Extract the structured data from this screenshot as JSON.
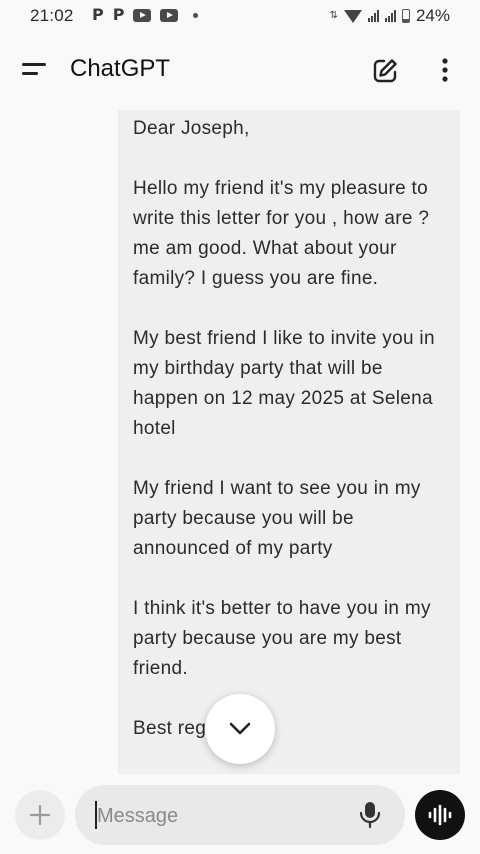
{
  "status_bar": {
    "time": "21:02",
    "notif_p1": "P",
    "notif_p2": "P",
    "battery": "24%",
    "icons": [
      "parking-icon",
      "parking-icon",
      "youtube-icon",
      "youtube-icon",
      "dot-icon",
      "data-arrows-icon",
      "wifi-icon",
      "signal-icon",
      "signal-icon",
      "battery-icon"
    ]
  },
  "header": {
    "title": "ChatGPT",
    "icons": [
      "menu-icon",
      "edit-icon",
      "more-vertical-icon"
    ]
  },
  "message": {
    "text": "Dear Joseph,\n\nHello my friend it's my pleasure to write this letter for you , how are ? me am good. What about your family? I guess you are fine.\n\nMy best friend I like to invite you in my birthday party that will be happen on 12 may 2025 at Selena\nhotel\n\nMy friend I want to see you in my party because you will be announced of my party\n\nI think it's better to have you in my party because you are my best friend.\n\nBest regards,"
  },
  "composer": {
    "placeholder": "Message",
    "value": "",
    "icons": [
      "plus-icon",
      "mic-icon",
      "voice-waveform-icon",
      "chevron-down-icon"
    ]
  },
  "colors": {
    "background": "#f9f9f9",
    "bubble": "#efefef",
    "input": "#e9e9e9",
    "voice_button": "#111111"
  }
}
